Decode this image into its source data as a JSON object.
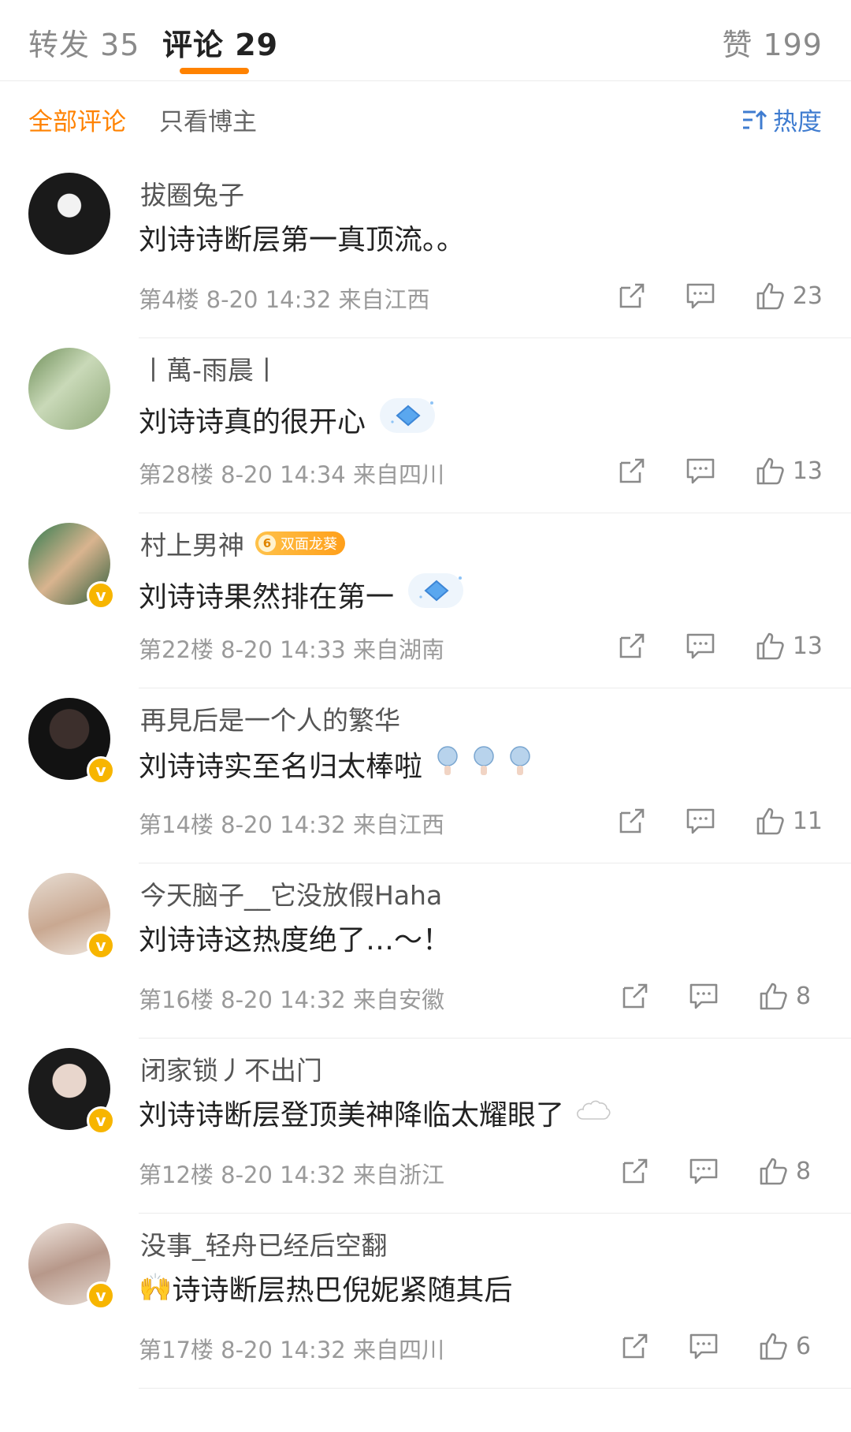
{
  "tabs": {
    "repost": "转发 35",
    "comments": "评论 29",
    "likes": "赞 199"
  },
  "filter": {
    "all": "全部评论",
    "author_only": "只看博主",
    "sort": "热度"
  },
  "colors": {
    "accent": "#ff8200",
    "link": "#3f7cd0",
    "vip": "#f7b500"
  },
  "comments": [
    {
      "user": "拔圈兔子",
      "text": "刘诗诗断层第一真顶流。。",
      "meta": "第4楼 8-20 14:32 来自江西",
      "likes": "23",
      "verified": false
    },
    {
      "user": "丨萬-雨晨丨",
      "text": "刘诗诗真的很开心",
      "meta": "第28楼 8-20 14:34 来自四川",
      "likes": "13",
      "verified": false,
      "sticker": "diamond-sticker"
    },
    {
      "user": "村上男神",
      "badge": "双面龙葵",
      "badge_level": "6",
      "text": "刘诗诗果然排在第一",
      "meta": "第22楼 8-20 14:33 来自湖南",
      "likes": "13",
      "verified": true,
      "sticker": "diamond-sticker"
    },
    {
      "user": "再見后是一个人的繁华",
      "text": "刘诗诗实至名归太棒啦",
      "meta": "第14楼 8-20 14:32 来自江西",
      "likes": "11",
      "verified": true,
      "sticker": "clap-sticker"
    },
    {
      "user": "今天脑子__它没放假Haha",
      "text": "刘诗诗这热度绝了…～！",
      "meta": "第16楼 8-20 14:32 来自安徽",
      "likes": "8",
      "verified": true
    },
    {
      "user": "闭家锁丿不出门",
      "text": "刘诗诗断层登顶美神降临太耀眼了",
      "meta": "第12楼 8-20 14:32 来自浙江",
      "likes": "8",
      "verified": true,
      "sticker": "cloud-sticker"
    },
    {
      "user": "没事_轻舟已经后空翻",
      "emoji": "🙌",
      "text": "诗诗断层热巴倪妮紧随其后",
      "meta": "第17楼 8-20 14:32 来自四川",
      "likes": "6",
      "verified": true
    }
  ]
}
